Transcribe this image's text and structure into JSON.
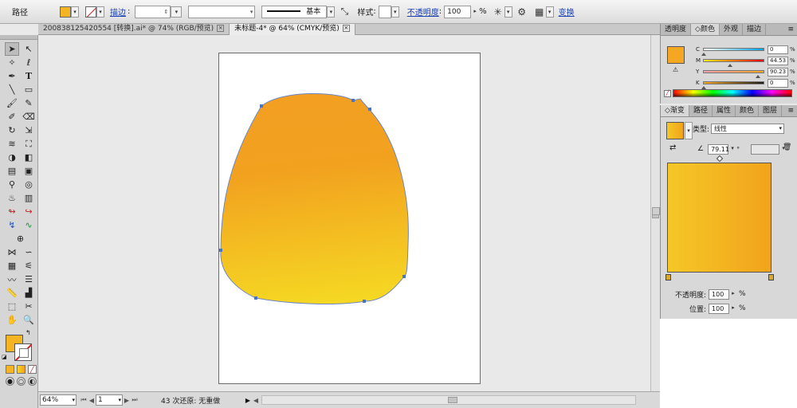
{
  "control_bar": {
    "selection_label": "路径",
    "fill_color": "#f5b523",
    "stroke_label": "描边",
    "stroke_weight": "",
    "brush_label": "基本",
    "style_label": "样式",
    "opacity_label": "不透明度",
    "opacity_value": "100",
    "opacity_unit": "%",
    "transform_label": "变换"
  },
  "document_tabs": [
    {
      "label": "200838125420554 [转换].ai* @ 74% (RGB/预览)",
      "active": false
    },
    {
      "label": "未标题-4* @ 64% (CMYK/预览)",
      "active": true
    }
  ],
  "status_bar": {
    "zoom": "64%",
    "artboard": "1",
    "undo_info": "43 次还原: 无重做"
  },
  "color_panel": {
    "tabs": [
      "透明度",
      "颜色",
      "外观",
      "描边"
    ],
    "active_tab": "颜色",
    "swatch_color": "#f5a623",
    "channels": [
      {
        "name": "C",
        "value": "0",
        "fraction": 0.0,
        "gradient": "linear-gradient(90deg,#ffffff,#00a0e9)"
      },
      {
        "name": "M",
        "value": "44.53",
        "fraction": 0.4453,
        "gradient": "linear-gradient(90deg,#f9f100,#e60012)"
      },
      {
        "name": "Y",
        "value": "90.23",
        "fraction": 0.9023,
        "gradient": "linear-gradient(90deg,#f39fb0,#f5a623)"
      },
      {
        "name": "K",
        "value": "0",
        "fraction": 0.0,
        "gradient": "linear-gradient(90deg,#f5a623,#1a1a1a)"
      }
    ],
    "unit": "%"
  },
  "gradient_panel": {
    "tabs": [
      "渐变",
      "路径",
      "属性",
      "颜色",
      "图层"
    ],
    "active_tab": "渐变",
    "type_label": "类型:",
    "type_value": "线性",
    "angle_value": "79.11",
    "angle_unit": "°",
    "start_color": "#f5c726",
    "end_color": "#f2a31c",
    "opacity_label": "不透明度:",
    "opacity_value": "100",
    "location_label": "位置:",
    "location_value": "100",
    "unit": "%"
  },
  "artwork": {
    "fill_top": "#f29f22",
    "fill_bottom": "#f5d823",
    "anchor_color": "#4a74c8"
  }
}
